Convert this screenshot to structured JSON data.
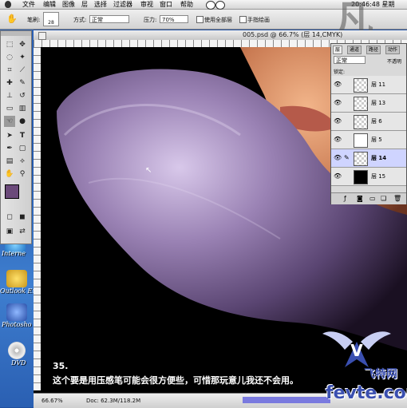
{
  "menubar": {
    "items": [
      "文件",
      "编辑",
      "图像",
      "层",
      "选择",
      "过滤器",
      "审视",
      "窗口",
      "帮助"
    ],
    "clock": "20:46:48 星期"
  },
  "options": {
    "brush_label": "笔刷:",
    "brush_size": "28",
    "mode_label": "方式:",
    "mode_value": "正常",
    "pressure_label": "压力:",
    "pressure_value": "70%",
    "check1": "使用全部层",
    "check2": "手指绘画"
  },
  "document": {
    "title": "005.psd @ 66.7% (层 14,CMYK)",
    "zoom": "66.67%",
    "doc_size": "Doc: 62.3M/118.2M"
  },
  "layers_palette": {
    "tabs": [
      "层",
      "通道",
      "路径",
      "动作"
    ],
    "blend_mode": "正常",
    "opacity_label": "不透明",
    "lock_label": "锁定:",
    "layers": [
      {
        "name": "层 11",
        "selected": false
      },
      {
        "name": "层 13",
        "selected": false
      },
      {
        "name": "层 6",
        "selected": false
      },
      {
        "name": "层 5",
        "selected": false
      },
      {
        "name": "层 14",
        "selected": true
      },
      {
        "name": "层 15",
        "selected": false
      }
    ]
  },
  "desktop": {
    "icons": [
      "Interne",
      "Outlook Ex",
      "Photosho",
      "DVD"
    ]
  },
  "caption": {
    "step": "35.",
    "text": "这个要是用压感笔可能会很方便些，可惜那玩意儿我还不会用。"
  },
  "watermark": {
    "cn": "飞特网",
    "url": "fevte.com"
  },
  "colors": {
    "desktop": "#2459ab",
    "fur": "#9a82b4",
    "foreground_swatch": "#6b4a7a",
    "watermark": "#3a4fb0"
  }
}
